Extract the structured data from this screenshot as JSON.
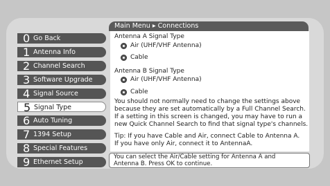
{
  "breadcrumb": {
    "root": "Main Menu",
    "separator": "▸",
    "current": "Connections"
  },
  "menu": [
    {
      "num": "0",
      "label": "Go Back"
    },
    {
      "num": "1",
      "label": "Antenna Info"
    },
    {
      "num": "2",
      "label": "Channel Search"
    },
    {
      "num": "3",
      "label": "Software Upgrade"
    },
    {
      "num": "4",
      "label": "Signal Source"
    },
    {
      "num": "5",
      "label": "Signal Type"
    },
    {
      "num": "6",
      "label": "Auto Tuning"
    },
    {
      "num": "7",
      "label": "1394 Setup"
    },
    {
      "num": "8",
      "label": "Special Features"
    },
    {
      "num": "9",
      "label": "Ethernet Setup"
    }
  ],
  "selected_index": 5,
  "antenna_a": {
    "title": "Antenna A Signal Type",
    "opt1": "Air (UHF/VHF Antenna)",
    "opt2": "Cable"
  },
  "antenna_b": {
    "title": "Antenna B Signal Type",
    "opt1": "Air (UHF/VHF Antenna)",
    "opt2": "Cable"
  },
  "info": {
    "l1": "You should not normally need to change the settings above",
    "l2": "because they are set automatically by a Full Channel Search.",
    "l3": "If a setting in this screen is changed, you may have to run a",
    "l4": "new Quick Channel Search to find that signal type's channels.",
    "t1": "Tip: If you have Cable and Air, connect Cable to Antenna A.",
    "t2": "If you have only Air, connect it to AntennaA."
  },
  "help": {
    "l1": "You can select the Air/Cable setting for Antenna A and",
    "l2": "Antenna B. Press OK to continue."
  },
  "colors": {
    "menu_bg": "#555555",
    "panel_bg": "#d9d9d9",
    "breadcrumb_bg": "#5a5a5a"
  }
}
